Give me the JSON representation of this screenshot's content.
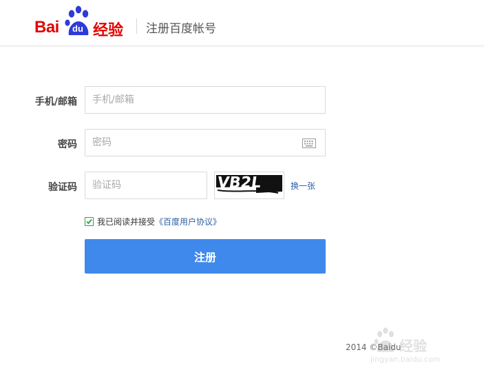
{
  "header": {
    "logo": {
      "wordmark": "Bai",
      "paw_text": "du",
      "product": "经验"
    },
    "title": "注册百度帐号"
  },
  "form": {
    "account": {
      "label": "手机/邮箱",
      "placeholder": "手机/邮箱",
      "value": ""
    },
    "password": {
      "label": "密码",
      "placeholder": "密码",
      "value": "",
      "icon": "keyboard-icon"
    },
    "captcha": {
      "label": "验证码",
      "placeholder": "验证码",
      "value": "",
      "image_text": "VB2L",
      "refresh_label": "换一张"
    },
    "agreement": {
      "checked": true,
      "text": "我已阅读并接受",
      "link_text": "《百度用户协议》"
    },
    "submit_label": "注册"
  },
  "footer": {
    "copyright": "2014 ©Baidu"
  },
  "watermark": {
    "text": "经验",
    "url": "jingyan.baidu.com"
  },
  "colors": {
    "brand_red": "#e10601",
    "primary_button": "#3f89ec",
    "link": "#2e5fa5",
    "checkbox": "#2e9f45"
  }
}
